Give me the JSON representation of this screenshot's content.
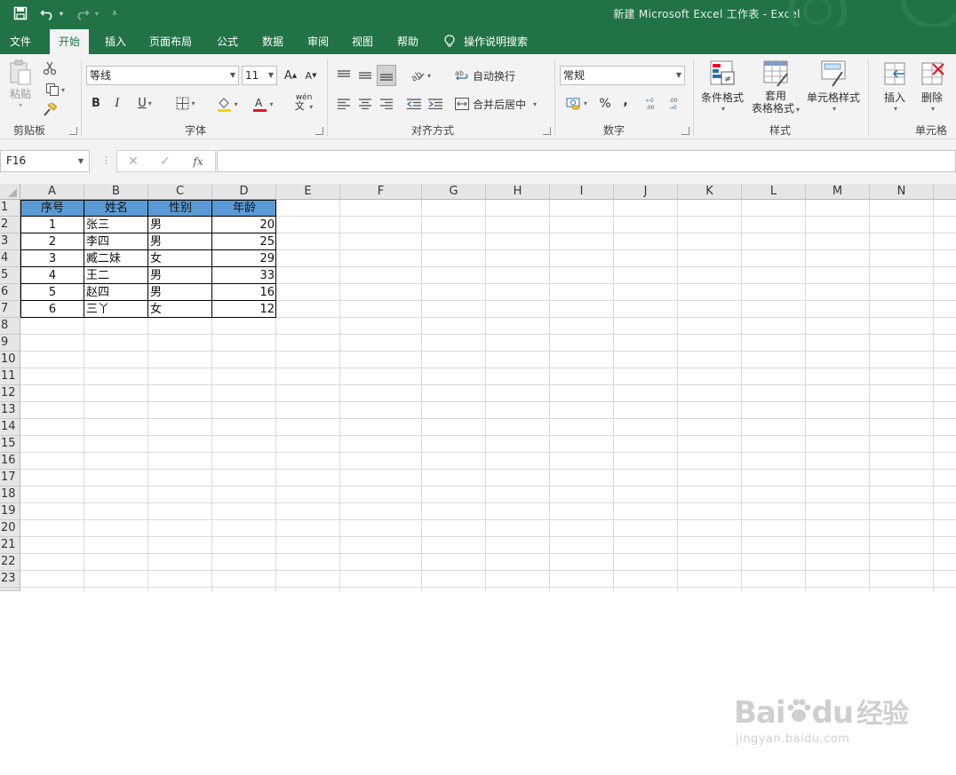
{
  "title": {
    "text": "新建 Microsoft Excel 工作表  -  Excel"
  },
  "tabs": [
    "文件",
    "开始",
    "插入",
    "页面布局",
    "公式",
    "数据",
    "审阅",
    "视图",
    "帮助",
    "操作说明搜索"
  ],
  "ribbon": {
    "clipboard": {
      "paste": "粘贴",
      "label": "剪贴板"
    },
    "font": {
      "name": "等线",
      "size": "11",
      "grow": "A",
      "shrink": "A",
      "bold": "B",
      "italic": "I",
      "underline": "U",
      "phonetic": "wén",
      "label": "字体"
    },
    "alignment": {
      "wrap": "自动换行",
      "merge": "合并后居中",
      "label": "对齐方式"
    },
    "number": {
      "format": "常规",
      "percent": "%",
      "comma": ",",
      "label": "数字"
    },
    "styles": {
      "conditional": "条件格式",
      "table_line1": "套用",
      "table_line2": "表格格式",
      "cell_styles": "单元格样式",
      "label": "样式"
    },
    "cells": {
      "insert": "插入",
      "delete": "删除",
      "label": "单元格"
    }
  },
  "formula_bar": {
    "name_box": "F16",
    "fx": "fx",
    "value": ""
  },
  "sheet": {
    "columns": [
      "A",
      "B",
      "C",
      "D",
      "E",
      "F",
      "G",
      "H",
      "I",
      "J",
      "K",
      "L",
      "M",
      "N"
    ],
    "rows": [
      "1",
      "2",
      "3",
      "4",
      "5",
      "6",
      "7",
      "8",
      "9",
      "10",
      "11",
      "12",
      "13",
      "14",
      "15",
      "16",
      "17",
      "18",
      "19",
      "20",
      "21",
      "22",
      "23"
    ],
    "header": [
      "序号",
      "姓名",
      "性别",
      "年龄"
    ],
    "data": [
      [
        "1",
        "张三",
        "男",
        "20"
      ],
      [
        "2",
        "李四",
        "男",
        "25"
      ],
      [
        "3",
        "臧二妹",
        "女",
        "29"
      ],
      [
        "4",
        "王二",
        "男",
        "33"
      ],
      [
        "5",
        "赵四",
        "男",
        "16"
      ],
      [
        "6",
        "三丫",
        "女",
        "12"
      ]
    ]
  },
  "watermark": {
    "brand": "Bai",
    "brand2": "du",
    "site_cn": "经验",
    "url": "jingyan.baidu.com"
  },
  "colors": {
    "excel_green": "#217346",
    "header_fill": "#5b9bd5",
    "font_red": "#e81123",
    "fill_yellow": "#ffd200"
  }
}
